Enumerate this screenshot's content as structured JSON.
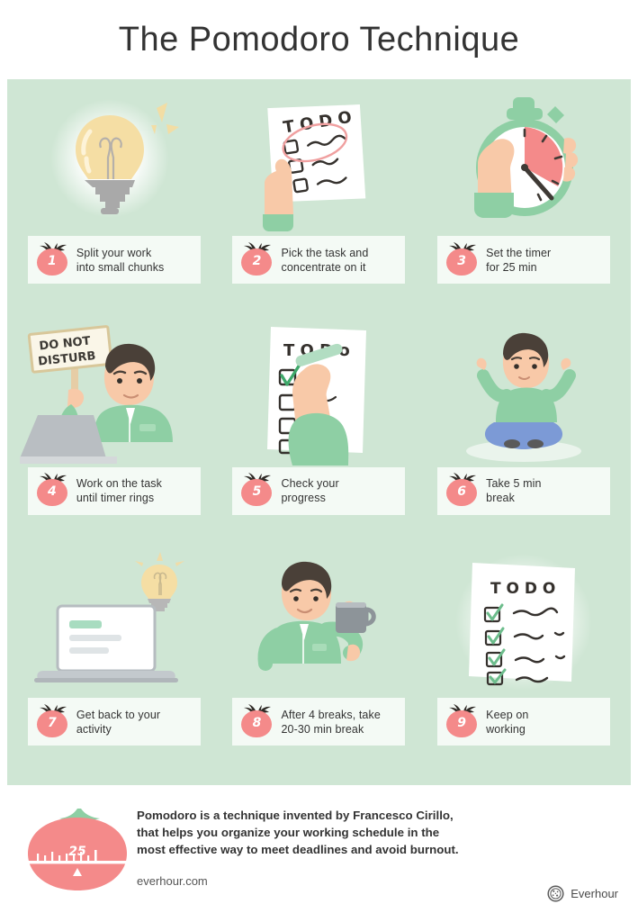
{
  "header": {
    "title": "The Pomodoro Technique"
  },
  "colors": {
    "panel_bg": "#cfe6d4",
    "card_bg": "#f4faf5",
    "tomato_red": "#f48a8a",
    "leaf_green": "#7cc49a",
    "shirt_green": "#8ecfa4",
    "skin": "#f8c9a8",
    "hair": "#4a4038",
    "paper": "#ffffff",
    "bulb_yellow": "#f5dea4",
    "text": "#333333"
  },
  "steps": [
    {
      "number": "1",
      "art": "lightbulb",
      "line1": "Split your work",
      "line2": "into small chunks"
    },
    {
      "number": "2",
      "art": "hand-holding-todo-list",
      "line1": "Pick the task and",
      "line2": "concentrate on it",
      "art_text": "TO DO"
    },
    {
      "number": "3",
      "art": "hand-holding-stopwatch",
      "line1": "Set the timer",
      "line2": "for 25 min"
    },
    {
      "number": "4",
      "art": "man-with-do-not-disturb-sign",
      "line1": "Work on the task",
      "line2": "until timer rings",
      "art_text": "DO NOT DISTURB",
      "art_text_line1": "DO NOT",
      "art_text_line2": "DISTURB"
    },
    {
      "number": "5",
      "art": "hand-checking-todo-list",
      "line1": "Check your",
      "line2": "progress",
      "art_text": "TO DO"
    },
    {
      "number": "6",
      "art": "man-meditating",
      "line1": "Take 5 min",
      "line2": "break"
    },
    {
      "number": "7",
      "art": "laptop-with-lightbulb",
      "line1": "Get back to your",
      "line2": "activity"
    },
    {
      "number": "8",
      "art": "man-with-coffee-mug",
      "line1": "After 4 breaks, take",
      "line2": "20-30 min break"
    },
    {
      "number": "9",
      "art": "completed-todo-list",
      "line1": "Keep on",
      "line2": "working",
      "art_text": "TO DO"
    }
  ],
  "footer": {
    "timer_label": "25",
    "description_line1": "Pomodoro is a technique invented by Francesco Cirillo,",
    "description_line2": "that helps you organize your working schedule in the",
    "description_line3": "most effective way to meet deadlines and avoid burnout.",
    "website": "everhour.com",
    "brand_name": "Everhour"
  }
}
